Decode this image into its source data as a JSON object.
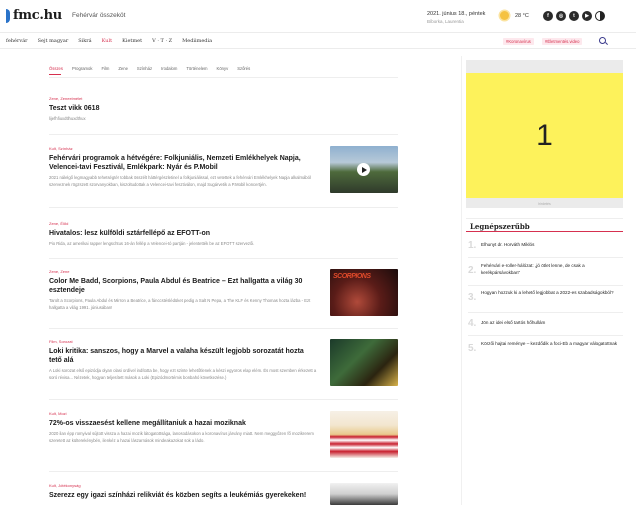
{
  "header": {
    "logo": "fmc.hu",
    "tagline": "Fehérvár összeköt",
    "date": "2021. június 18., péntek",
    "nameday": "Bíborka, Laurentia",
    "temperature": "28 °C",
    "social": [
      "f",
      "◎",
      "t",
      "▶"
    ]
  },
  "nav": {
    "items": [
      "fehérvár",
      "Sejt magyar",
      "Sikrá",
      "Kult",
      "Kietmet",
      "V · T · Z",
      "Mediimedia"
    ],
    "active_index": 3,
    "tags": [
      "#Koronavírus",
      "#Életmentés.video"
    ]
  },
  "category_tabs": {
    "items": [
      "Összes",
      "Programok",
      "Film",
      "Zene",
      "Színház",
      "Irodalom",
      "Történelem",
      "Könyv",
      "Szőrés"
    ],
    "active_index": 0
  },
  "articles": [
    {
      "tag": "Zene, Zeneelmélet",
      "title": "Teszt vikk 0618",
      "lead": "lijefhfiuxdtlhuxdthux",
      "image": null
    },
    {
      "tag": "Kult, Színház",
      "title": "Fehérvári programok a hétvégére: Folkjuniális, Nemzeti Emlékhelyek Napja, Velencei-tavi Fesztivál, Emlékpark: Nyár és P.Mobil",
      "lead": "2021 nálelgő legmagyabb tehetségtér tobbak összélt háttérgészletinel a folkjuniálissal, ezt vetettek a fehérvári Emlékhelyek Napja alkalmából szerveznek rögzszett szorvanyokban, kiszoltudottak a Velencei-tavi fesztiválon, majd Sugárvetik a P.Mobil koncertjén.",
      "image": "crowd-video"
    },
    {
      "tag": "Zene, Élőd",
      "title": "Hivatalos: lesz külföldi sztárfellépő az EFOTT-on",
      "lead": "Pio Rida, az amerikai rapper lengschtus 16-án fellép a Velencei-tó partján - jelentették be az EFOTT szervezői.",
      "image": null
    },
    {
      "tag": "Zene, Zene",
      "title": "Color Me Badd, Scorpions, Paula Abdul és Beatrice – Ezt hallgatta a világ 30 esztendeje",
      "lead": "Tarolt a Scorpions, Paula Abdul és Mirron a Beatrice, a fánccstéslédüket pedig a Salt N Pepa, a The KLF és Kenny Thomas hozta lázba - Ezt hallgatta a világ 1991. júniusában!",
      "image": "scorpions"
    },
    {
      "tag": "Film, Sorozat",
      "title": "Loki kritika: sanszos, hogy a Marvel a valaha készült legjobb sorozatát hozta tető alá",
      "lead": "A Loki sorozat első epizódja olyan olasi ordível indította be, hogy ezt szinte lehetőtlenek a készi egyoros elap elém. És most szemben érkezett a soró révisa... Nézetek, hogyan teljesített mások a Loki (Epizódmortémis bonbahó következése.)",
      "image": "loki"
    },
    {
      "tag": "Kult, Mozi",
      "title": "72%-os visszaesést kellene megállítaniuk a hazai moziknak",
      "lead": "2020 ilan épp romyival sújtott vissza a hazai mozik látogatottsága, lanosodásokon a koronavírus járvány miatt. Nem meggyőzen fő mozikrerem szeretett az külterekénybén, ilenkéz a hazai lászarnások mindeakazokat sok a ládo.",
      "image": "popcorn"
    },
    {
      "tag": "Kult, Jótékonyság",
      "title": "Szerezz egy igazi színházi relikviát és közben segíts a leukémiás gyerekeken!",
      "lead": "",
      "image": "theatre"
    }
  ],
  "sidebar": {
    "ad_number": "1",
    "ad_label": "hirdetés",
    "popular_title": "Legnépszerűbb",
    "popular": [
      {
        "num": "1.",
        "text": "Elhunyt dr. Horváth Miklós"
      },
      {
        "num": "2.",
        "text": "Fehérvári e-roller-hálózat: „jó ötlet lenne, de csak a kerékpársávokban\""
      },
      {
        "num": "3.",
        "text": "Hogyan hozzuk ki a lehető legjobbat a 2022-es szabadságokból?"
      },
      {
        "num": "4.",
        "text": "Jön az idei első tartós hőhullám"
      },
      {
        "num": "5.",
        "text": "Körzői hajtai reménye – kezdődik a foci-Eb a magyar válogatottnak"
      }
    ]
  },
  "colors": {
    "accent": "#d6304f",
    "logo_blue": "#2a73c9",
    "ad_yellow": "#fdf25b"
  }
}
